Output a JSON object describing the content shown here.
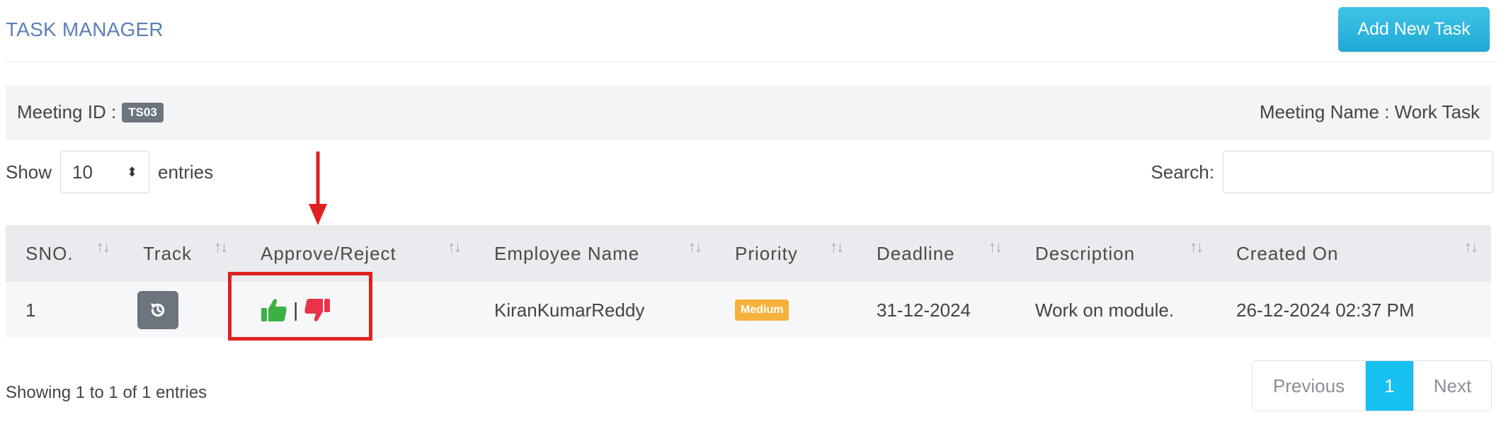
{
  "header": {
    "title": "TASK MANAGER",
    "add_button": "Add New Task"
  },
  "meeting": {
    "id_label": "Meeting ID :",
    "id_value": "TS03",
    "name_text": "Meeting Name : Work Task"
  },
  "controls": {
    "show_label": "Show",
    "entries_value": "10",
    "entries_label": "entries",
    "search_label": "Search:",
    "search_value": ""
  },
  "table": {
    "columns": [
      "SNO.",
      "Track",
      "Approve/Reject",
      "Employee Name",
      "Priority",
      "Deadline",
      "Description",
      "Created On"
    ],
    "rows": [
      {
        "sno": "1",
        "separator": "|",
        "employee": "KiranKumarReddy",
        "priority": "Medium",
        "deadline": "31-12-2024",
        "description": "Work on module.",
        "created": "26-12-2024 02:37 PM"
      }
    ]
  },
  "footer": {
    "info": "Showing 1 to 1 of 1 entries",
    "prev": "Previous",
    "page": "1",
    "next": "Next"
  },
  "colors": {
    "approve": "#3cb043",
    "reject": "#e8334a",
    "priority_medium": "#f5b13a",
    "annotation": "#e02020",
    "active_page": "#17c1f0"
  },
  "icons": {
    "track": "history-icon",
    "approve": "thumbs-up-icon",
    "reject": "thumbs-down-icon",
    "sort": "sort-icon",
    "annotation_arrow": "arrow-down-icon"
  }
}
